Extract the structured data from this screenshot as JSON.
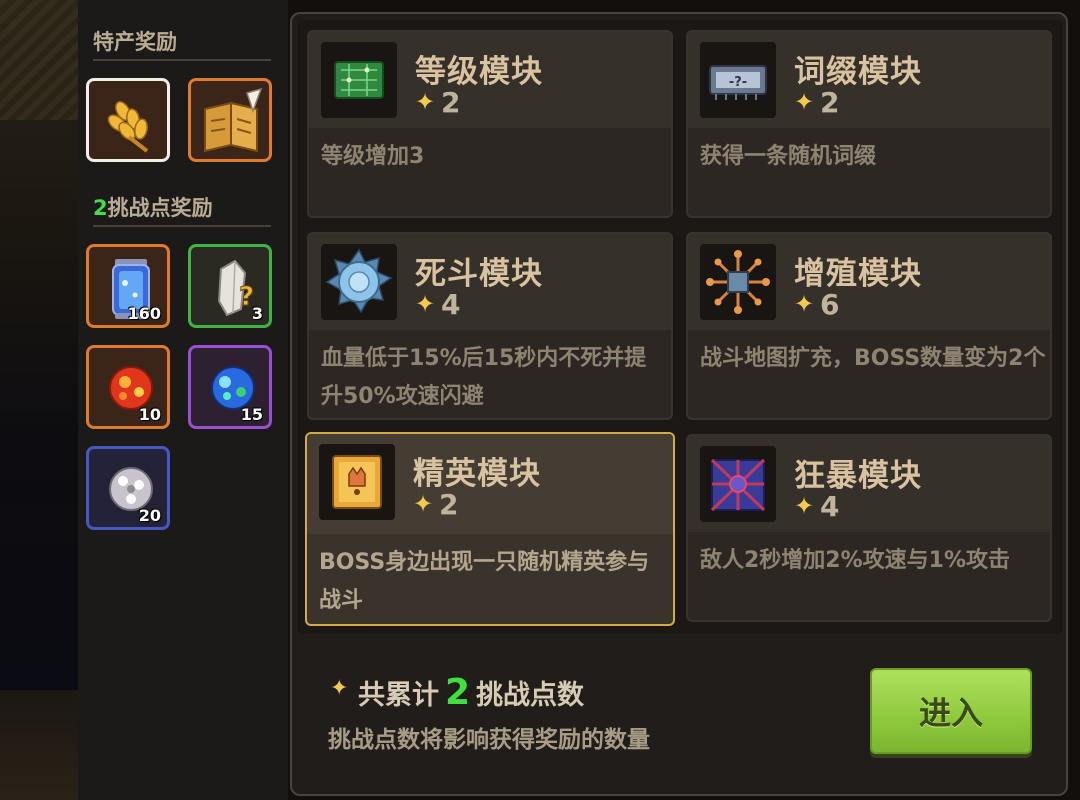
{
  "sidebar": {
    "special_title": "特产奖励",
    "challenge_title_num": "2",
    "challenge_title_text": "挑战点奖励",
    "special_items": [
      {
        "icon": "wheat-icon",
        "border": "white"
      },
      {
        "icon": "quest-map-icon",
        "border": "orange"
      }
    ],
    "challenge_items": [
      {
        "icon": "potion-jar-icon",
        "count": "160",
        "border": "orange"
      },
      {
        "icon": "mystery-crystal-icon",
        "count": "3",
        "border": "green"
      },
      {
        "icon": "red-orb-icon",
        "count": "10",
        "border": "orange"
      },
      {
        "icon": "blue-orb-icon",
        "count": "15",
        "border": "purple"
      },
      {
        "icon": "silver-orb-icon",
        "count": "20",
        "border": "blue"
      }
    ]
  },
  "modules": [
    {
      "name": "等级模块",
      "points": "2",
      "desc": "等级增加3",
      "icon": "circuit-board-icon",
      "selected": false
    },
    {
      "name": "词缀模块",
      "points": "2",
      "desc": "获得一条随机词缀",
      "icon": "mystery-chip-icon",
      "selected": false
    },
    {
      "name": "死斗模块",
      "points": "4",
      "desc": "血量低于15%后15秒内不死并提升50%攻速闪避",
      "icon": "spiked-shield-icon",
      "selected": false
    },
    {
      "name": "增殖模块",
      "points": "6",
      "desc": "战斗地图扩充，BOSS数量变为2个",
      "icon": "multiply-chip-icon",
      "selected": false
    },
    {
      "name": "精英模块",
      "points": "2",
      "desc": "BOSS身边出现一只随机精英参与战斗",
      "icon": "elite-card-icon",
      "selected": true
    },
    {
      "name": "狂暴模块",
      "points": "4",
      "desc": "敌人2秒增加2%攻速与1%攻击",
      "icon": "berserk-chip-icon",
      "selected": false
    }
  ],
  "footer": {
    "total_prefix": "共累计",
    "total_value": "2",
    "total_suffix": "挑战点数",
    "hint": "挑战点数将影响获得奖励的数量",
    "enter_label": "进入"
  },
  "colors": {
    "accent_green": "#3fe03f",
    "button_green": "#8ec93d",
    "selected_gold": "#d4ac45",
    "star": "#f2c94c"
  }
}
